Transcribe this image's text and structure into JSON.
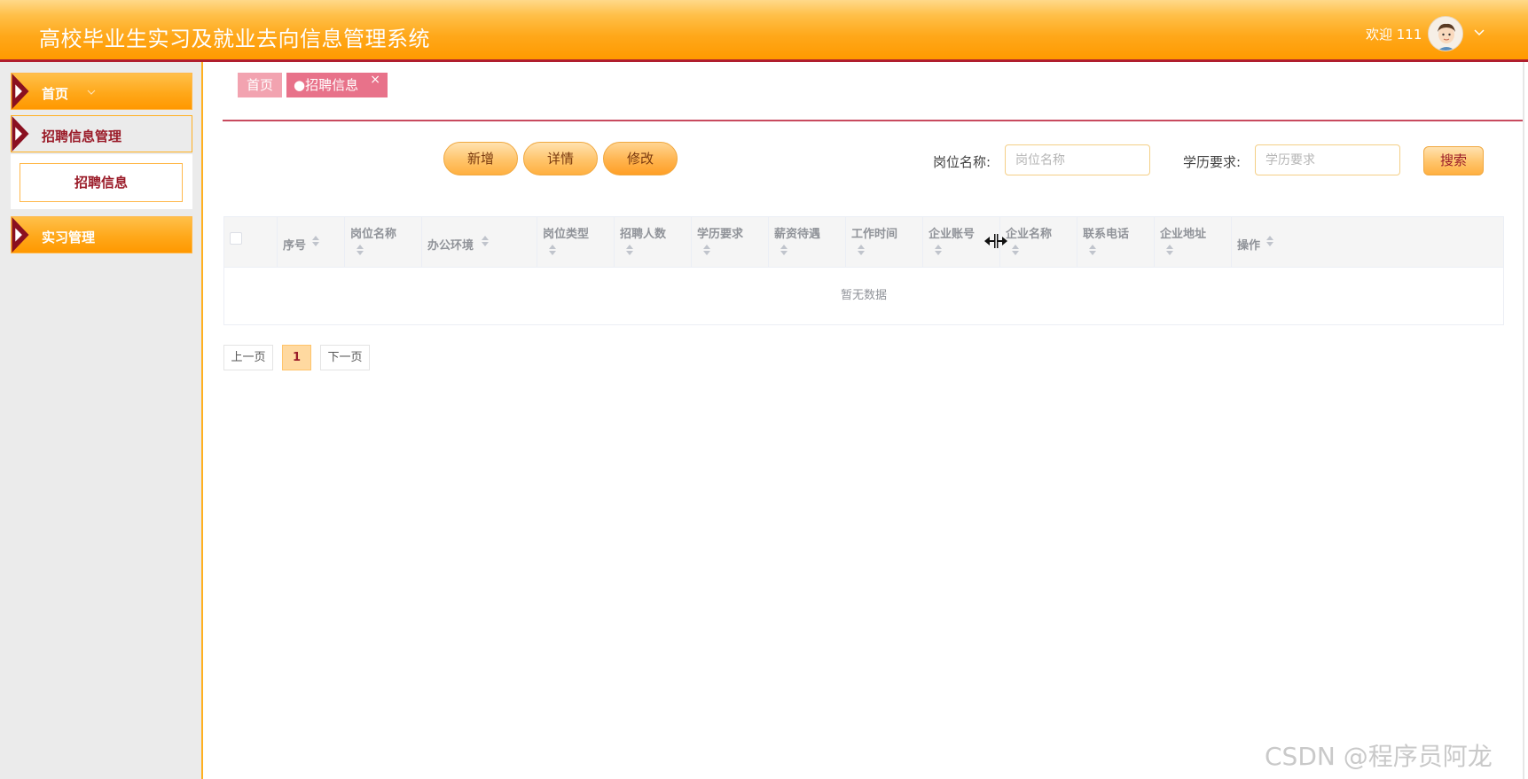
{
  "header": {
    "title": "高校毕业生实习及就业去向信息管理系统",
    "welcome": "欢迎 111"
  },
  "sidebar": {
    "items": [
      {
        "label": "首页"
      },
      {
        "label": "招聘信息管理"
      },
      {
        "label": "招聘信息"
      },
      {
        "label": "实习管理"
      }
    ]
  },
  "tabs": [
    {
      "label": "首页"
    },
    {
      "label": "●招聘信息",
      "close": "×"
    }
  ],
  "actions": {
    "add": "新增",
    "detail": "详情",
    "edit": "修改"
  },
  "search": {
    "position_label": "岗位名称:",
    "position_placeholder": "岗位名称",
    "edu_label": "学历要求:",
    "edu_placeholder": "学历要求",
    "button": "搜索"
  },
  "table": {
    "columns": [
      "序号",
      "岗位名称",
      "办公环境",
      "岗位类型",
      "招聘人数",
      "学历要求",
      "薪资待遇",
      "工作时间",
      "企业账号",
      "企业名称",
      "联系电话",
      "企业地址",
      "操作"
    ],
    "empty_text": "暂无数据"
  },
  "pagination": {
    "prev": "上一页",
    "current": "1",
    "next": "下一页"
  },
  "watermark": "CSDN @程序员阿龙",
  "colors": {
    "header": "#ff9a00",
    "accent": "#9a1b28",
    "tab_active": "#e8728a"
  }
}
